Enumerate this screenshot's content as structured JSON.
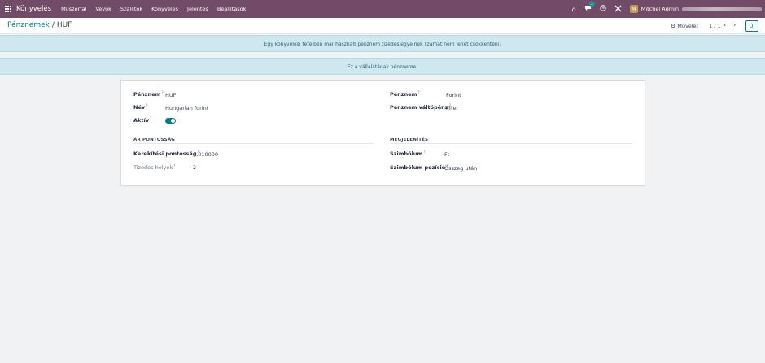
{
  "navbar": {
    "brand": "Könyvelés",
    "menu": [
      "Műszerfal",
      "Vevők",
      "Szállítók",
      "Könyvelés",
      "Jelentés",
      "Beállítások"
    ],
    "messages_badge": "1",
    "avatar_letter": "M",
    "user_name": "Mitchel Admin"
  },
  "control": {
    "breadcrumb_parent": "Pénznemek",
    "breadcrumb_current": "HUF",
    "action_label": "Művelet",
    "pager": "1 / 1",
    "new_label": "Új"
  },
  "alerts": {
    "decimal_warning": "Egy könyvelési tételben már használt pénznem tizedesjegyeinek számát nem lehet csökkenteni.",
    "company_currency": "Ez a vállalatának pénzneme."
  },
  "form": {
    "left": {
      "currency_label": "Pénznem",
      "currency_value": "HUF",
      "name_label": "Név",
      "name_value": "Hungarian forint",
      "active_label": "Aktív"
    },
    "right": {
      "currency_label": "Pénznem",
      "currency_value": "Forint",
      "subunit_label": "Pénznem váltópénz",
      "subunit_value": "Filler"
    },
    "price_accuracy": {
      "title": "ÁR PONTOSSÁG",
      "rounding_label": "Kerekítési pontosság",
      "rounding_value": "0,010000",
      "decimals_label": "Tizedes helyek",
      "decimals_value": "2"
    },
    "display": {
      "title": "MEGJELENÍTÉS",
      "symbol_label": "Szimbólum",
      "symbol_value": "Ft",
      "position_label": "Szimbólum pozíció",
      "position_value": "Összeg után"
    },
    "help_mark": "?"
  }
}
